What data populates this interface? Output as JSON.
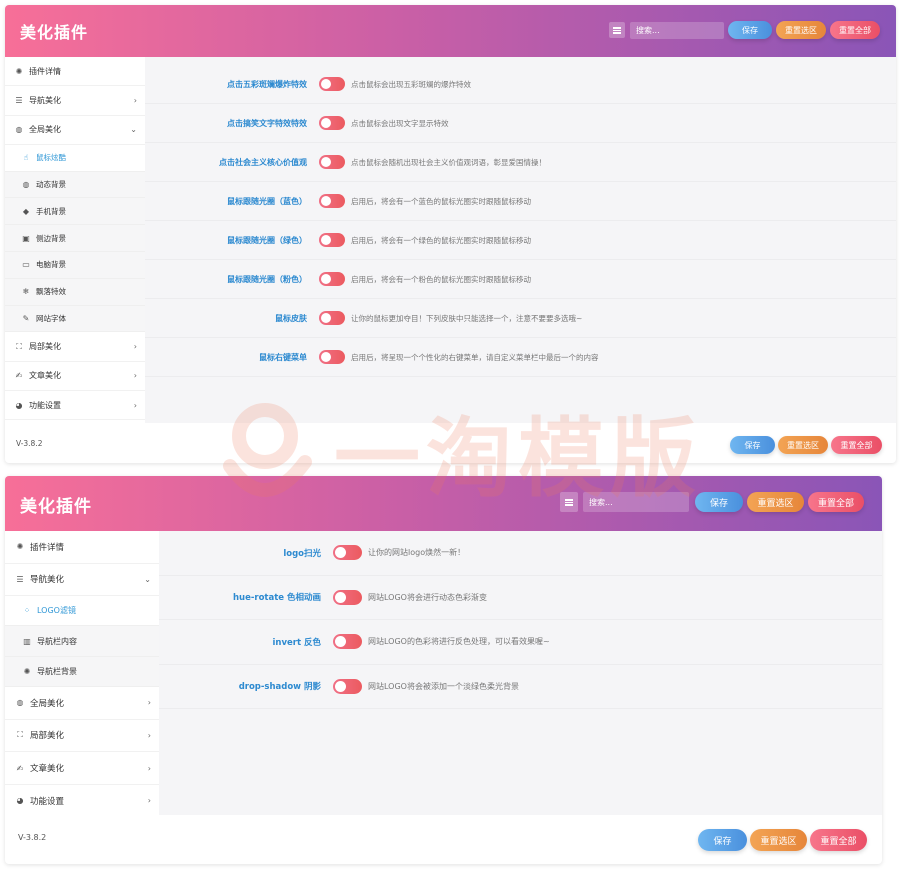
{
  "colors": {
    "accent_label": "#2d8ad0",
    "toggle": "#ec5a5f",
    "save": "#4a90dd",
    "reset": "#e6863a",
    "reset_all": "#ea4f66",
    "header_from": "#f76f98",
    "header_to": "#8a55b7"
  },
  "panel1": {
    "header": {
      "title": "美化插件",
      "search_placeholder": "搜索...",
      "save": "保存",
      "reset": "重置选区",
      "reset_all": "重置全部"
    },
    "sidebar": [
      {
        "label": "插件详情",
        "icon": "fan-icon",
        "glyph": "✺"
      },
      {
        "label": "导航美化",
        "icon": "list-icon",
        "glyph": "☰",
        "chevron": "›"
      },
      {
        "label": "全局美化",
        "icon": "globe-icon",
        "glyph": "◍",
        "chevron": "⌄"
      },
      {
        "label": "鼠标炫酷",
        "icon": "pointer-icon",
        "glyph": "☝"
      },
      {
        "label": "动态背景",
        "icon": "globe-icon",
        "glyph": "◍"
      },
      {
        "label": "手机背景",
        "icon": "diamond-icon",
        "glyph": "◆"
      },
      {
        "label": "侧边背景",
        "icon": "image-icon",
        "glyph": "▣"
      },
      {
        "label": "电脑背景",
        "icon": "monitor-icon",
        "glyph": "▭"
      },
      {
        "label": "飘落特效",
        "icon": "snowflake-icon",
        "glyph": "❄"
      },
      {
        "label": "网站字体",
        "icon": "pencil-icon",
        "glyph": "✎"
      },
      {
        "label": "局部美化",
        "icon": "frame-icon",
        "glyph": "⛶",
        "chevron": "›"
      },
      {
        "label": "文章美化",
        "icon": "edit-icon",
        "glyph": "✍",
        "chevron": "›"
      },
      {
        "label": "功能设置",
        "icon": "pie-icon",
        "glyph": "◕",
        "chevron": "›"
      }
    ],
    "settings": [
      {
        "label": "点击五彩斑斓爆炸特效",
        "desc": "点击鼠标会出现五彩斑斓的爆炸特效"
      },
      {
        "label": "点击搞笑文字特效特效",
        "desc": "点击鼠标会出现文字显示特效"
      },
      {
        "label": "点击社会主义核心价值观",
        "desc": "点击鼠标会随机出现社会主义价值观词语，彰显爱国情操！"
      },
      {
        "label": "鼠标跟随光圈（蓝色）",
        "desc": "启用后，将会有一个蓝色的鼠标光圈实时跟随鼠标移动"
      },
      {
        "label": "鼠标跟随光圈（绿色）",
        "desc": "启用后，将会有一个绿色的鼠标光圈实时跟随鼠标移动"
      },
      {
        "label": "鼠标跟随光圈（粉色）",
        "desc": "启用后，将会有一个粉色的鼠标光圈实时跟随鼠标移动"
      },
      {
        "label": "鼠标皮肤",
        "desc": "让你的鼠标更加夺目！下列皮肤中只能选择一个，注意不要要多选哦~"
      },
      {
        "label": "鼠标右键菜单",
        "desc": "启用后，将呈现一个个性化的右键菜单，请自定义菜单栏中最后一个的内容"
      }
    ],
    "footer": {
      "version": "V-3.8.2",
      "save": "保存",
      "reset": "重置选区",
      "reset_all": "重置全部"
    }
  },
  "panel2": {
    "header": {
      "title": "美化插件",
      "search_placeholder": "搜索...",
      "save": "保存",
      "reset": "重置选区",
      "reset_all": "重置全部"
    },
    "sidebar": [
      {
        "label": "插件详情",
        "icon": "fan-icon",
        "glyph": "✺"
      },
      {
        "label": "导航美化",
        "icon": "list-icon",
        "glyph": "☰",
        "chevron": "⌄"
      },
      {
        "label": "LOGO滤镜",
        "icon": "spinner-icon",
        "glyph": "⁘"
      },
      {
        "label": "导航栏内容",
        "icon": "bar-chart-icon",
        "glyph": "▥"
      },
      {
        "label": "导航栏背景",
        "icon": "fan-icon",
        "glyph": "✺"
      },
      {
        "label": "全局美化",
        "icon": "globe-icon",
        "glyph": "◍",
        "chevron": "›"
      },
      {
        "label": "局部美化",
        "icon": "frame-icon",
        "glyph": "⛶",
        "chevron": "›"
      },
      {
        "label": "文章美化",
        "icon": "edit-icon",
        "glyph": "✍",
        "chevron": "›"
      },
      {
        "label": "功能设置",
        "icon": "pie-icon",
        "glyph": "◕",
        "chevron": "›"
      }
    ],
    "settings": [
      {
        "label": "logo扫光",
        "desc": "让你的网站logo焕然一新！"
      },
      {
        "label": "hue-rotate 色相动画",
        "desc": "网站LOGO将会进行动态色彩渐变"
      },
      {
        "label": "invert 反色",
        "desc": "网站LOGO的色彩将进行反色处理，可以看效果喔~"
      },
      {
        "label": "drop-shadow 阴影",
        "desc": "网站LOGO将会被添加一个淡绿色柔光背景"
      }
    ],
    "footer": {
      "version": "V-3.8.2",
      "save": "保存",
      "reset": "重置选区",
      "reset_all": "重置全部"
    }
  },
  "watermark": {
    "text": "一淘模版"
  }
}
